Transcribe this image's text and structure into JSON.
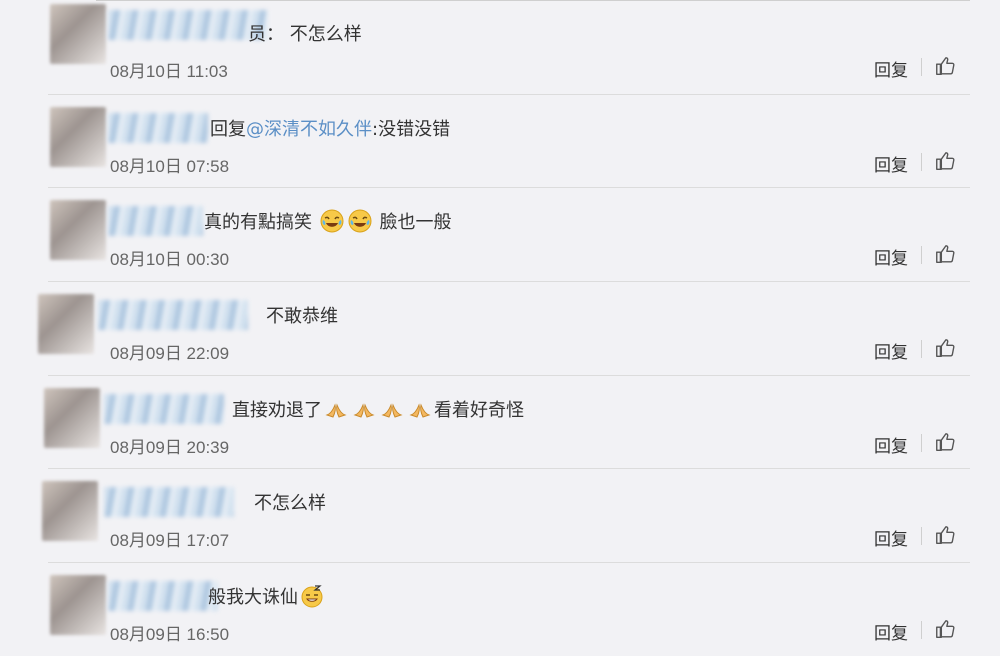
{
  "comments": [
    {
      "prefix": "",
      "text_before": "员：  不怎么样",
      "mention": "",
      "text_after": "",
      "emojis_before": [],
      "emojis_after": [],
      "time": "08月10日 11:03",
      "reply": "回复"
    },
    {
      "prefix": "回复",
      "text_before": "",
      "mention": "@深清不如久伴",
      "text_after": ":没错没错",
      "emojis_before": [],
      "emojis_after": [],
      "time": "08月10日 07:58",
      "reply": "回复"
    },
    {
      "prefix": "",
      "text_before": "真的有點搞笑",
      "mention": "",
      "text_after": " 臉也一般",
      "emojis": [
        "crying-laughing-emoji",
        "crying-laughing-emoji"
      ],
      "time": "08月10日 00:30",
      "reply": "回复"
    },
    {
      "prefix": "",
      "text_before": "不敢恭维",
      "mention": "",
      "text_after": "",
      "emojis": [],
      "time": "08月09日 22:09",
      "reply": "回复"
    },
    {
      "prefix": "",
      "text_before": "直接劝退了",
      "mention": "",
      "text_after": "看着好奇怪",
      "emojis": [
        "folded-hands-emoji",
        "folded-hands-emoji",
        "folded-hands-emoji",
        "folded-hands-emoji"
      ],
      "time": "08月09日 20:39",
      "reply": "回复"
    },
    {
      "prefix": "",
      "text_before": "不怎么样",
      "mention": "",
      "text_after": "",
      "emojis": [],
      "time": "08月09日 17:07",
      "reply": "回复"
    },
    {
      "prefix": "",
      "text_before": "般我大诛仙",
      "mention": "",
      "text_after": "",
      "emojis": [
        "sleepy-grin-emoji"
      ],
      "time": "08月09日 16:50",
      "reply": "回复"
    }
  ]
}
